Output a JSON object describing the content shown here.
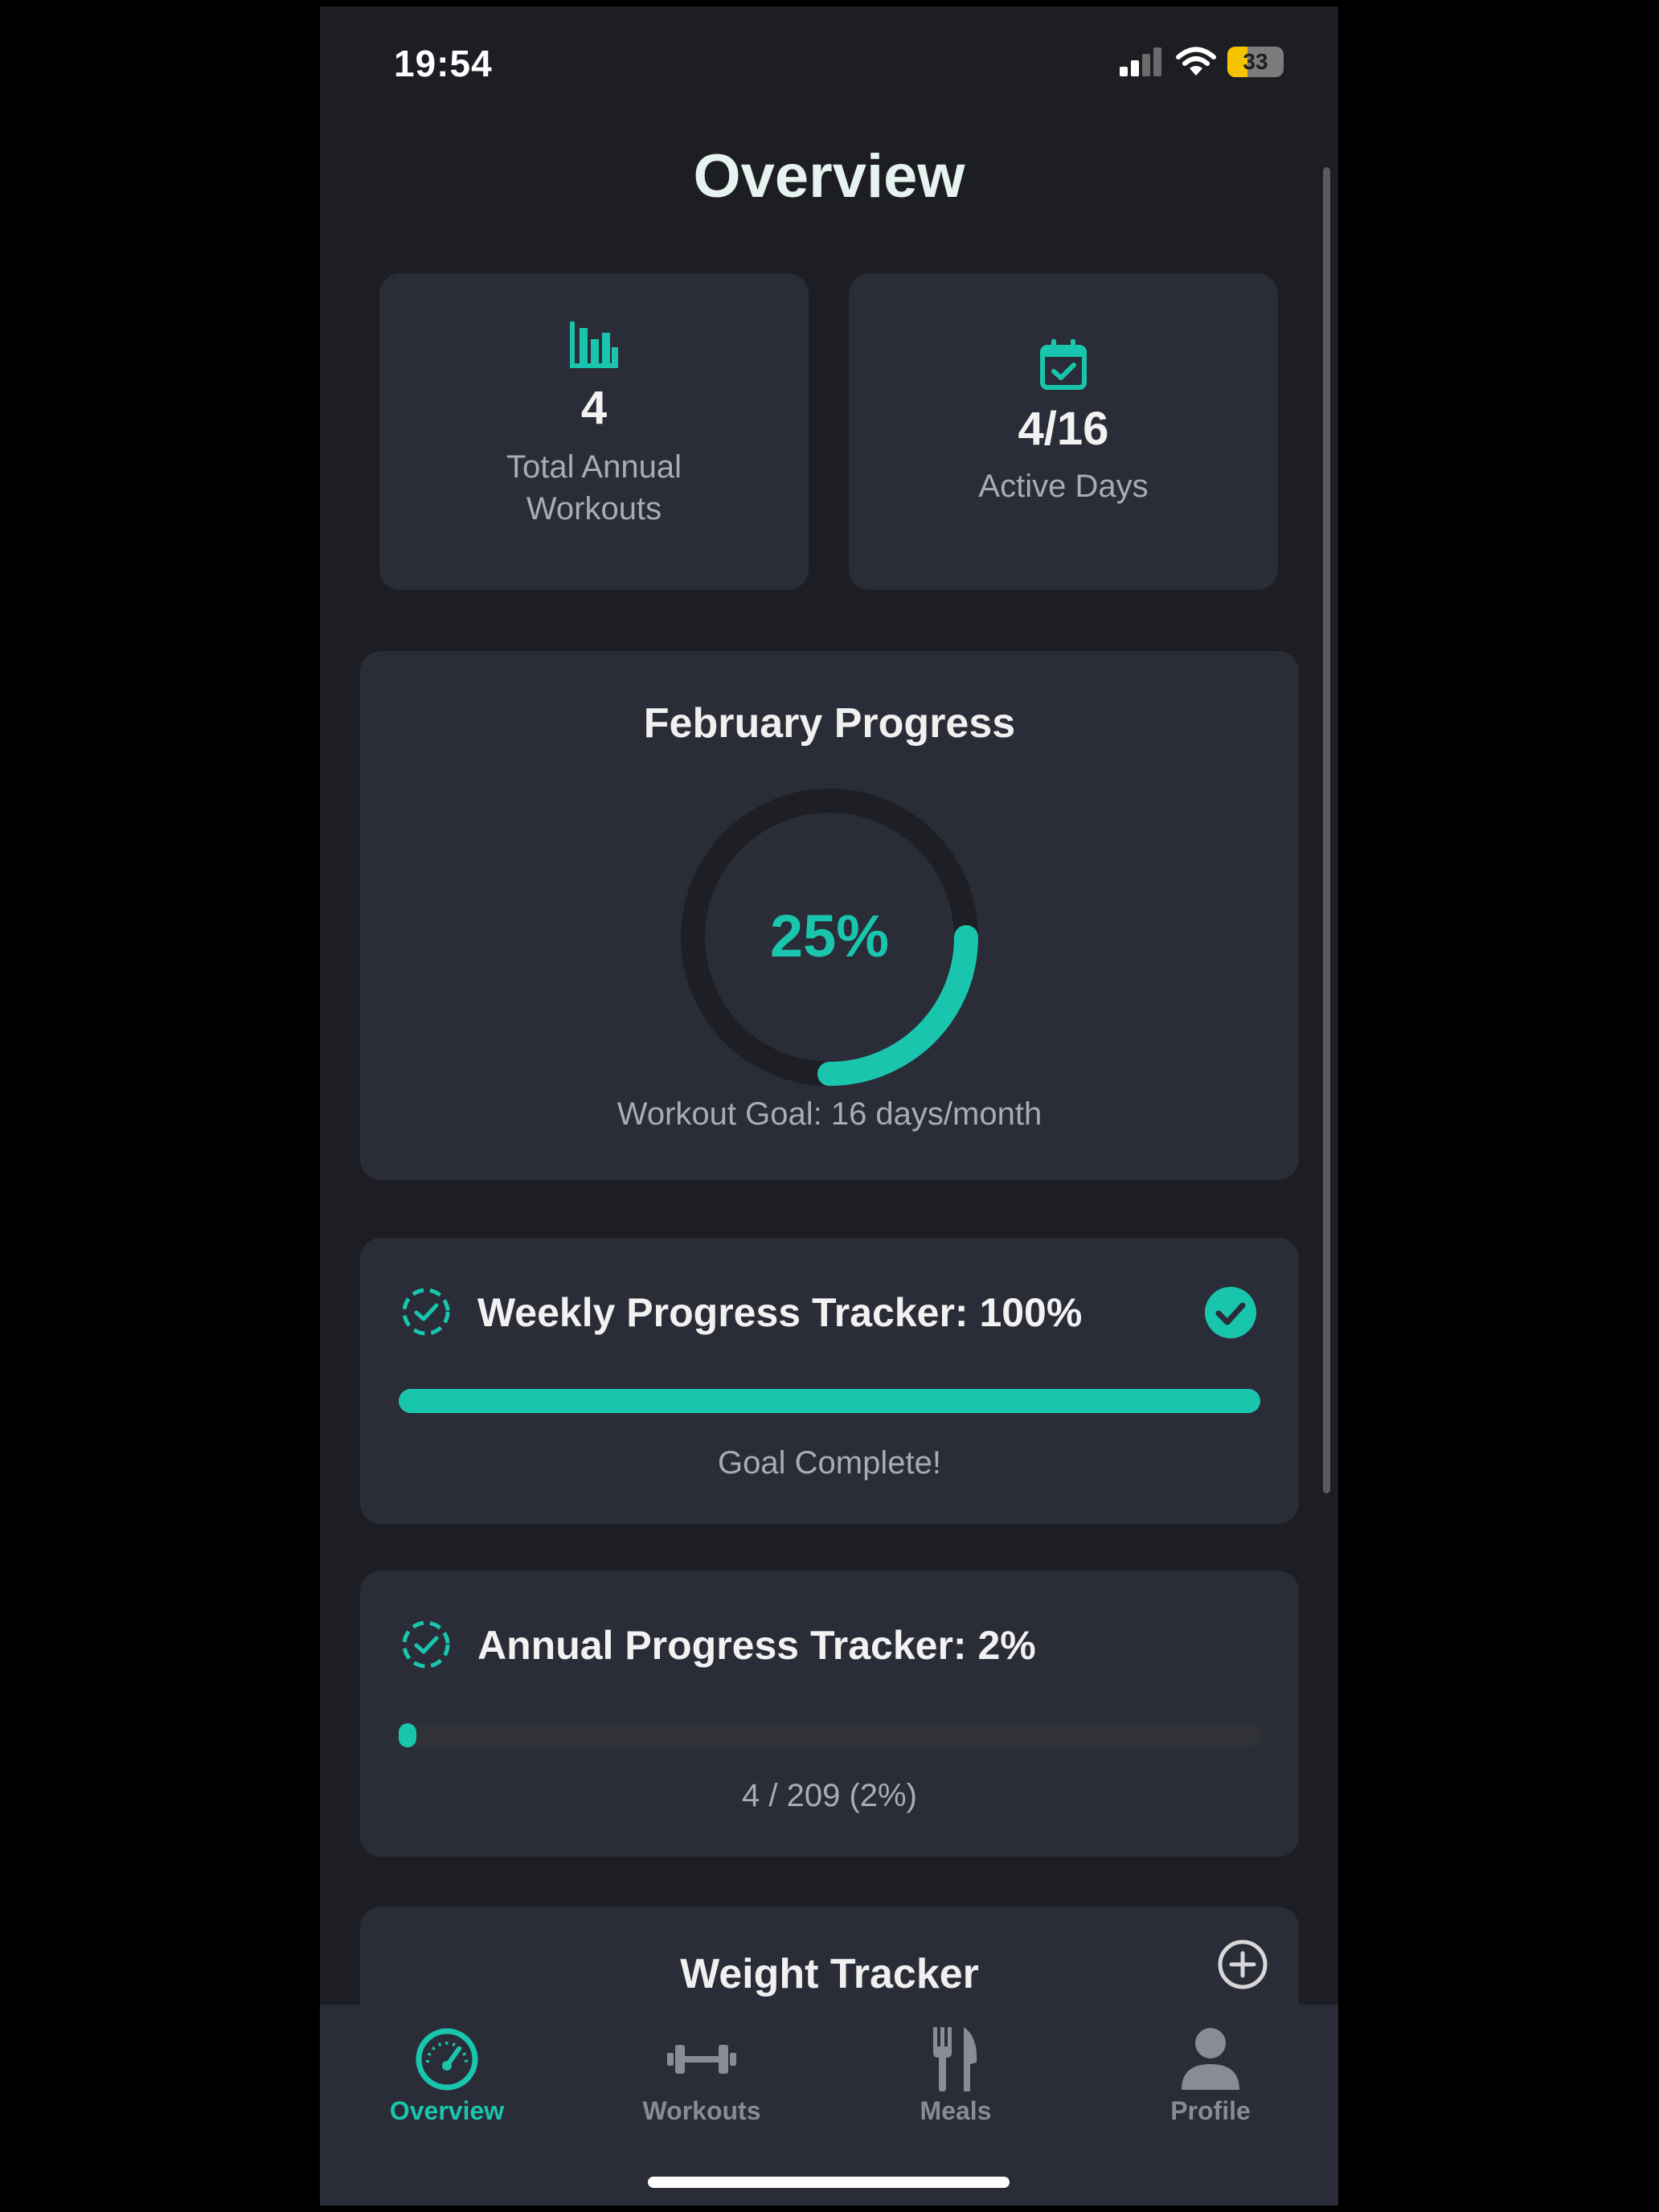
{
  "status": {
    "time": "19:54",
    "battery": "33"
  },
  "page": {
    "title": "Overview"
  },
  "stats": [
    {
      "icon": "bar-chart-icon",
      "value": "4",
      "label_line1": "Total Annual",
      "label_line2": "Workouts"
    },
    {
      "icon": "calendar-check-icon",
      "value": "4/16",
      "label_line1": "Active Days",
      "label_line2": ""
    }
  ],
  "monthly": {
    "title": "February Progress",
    "percent_text": "25%",
    "progress": 0.25,
    "goal_text": "Workout Goal: 16 days/month"
  },
  "weekly": {
    "title": "Weekly Progress Tracker: 100%",
    "progress": 1.0,
    "status_text": "Goal Complete!"
  },
  "annual": {
    "title": "Annual Progress Tracker: 2%",
    "progress": 0.02,
    "detail_text": "4 / 209 (2%)"
  },
  "weight": {
    "title": "Weight Tracker"
  },
  "tabs": [
    {
      "label": "Overview",
      "icon": "speedometer-icon",
      "active": true
    },
    {
      "label": "Workouts",
      "icon": "dumbbell-icon",
      "active": false
    },
    {
      "label": "Meals",
      "icon": "fork-knife-icon",
      "active": false
    },
    {
      "label": "Profile",
      "icon": "person-icon",
      "active": false
    }
  ],
  "colors": {
    "accent": "#19c6ad",
    "background": "#1d1e23",
    "card": "#2a2c37"
  }
}
